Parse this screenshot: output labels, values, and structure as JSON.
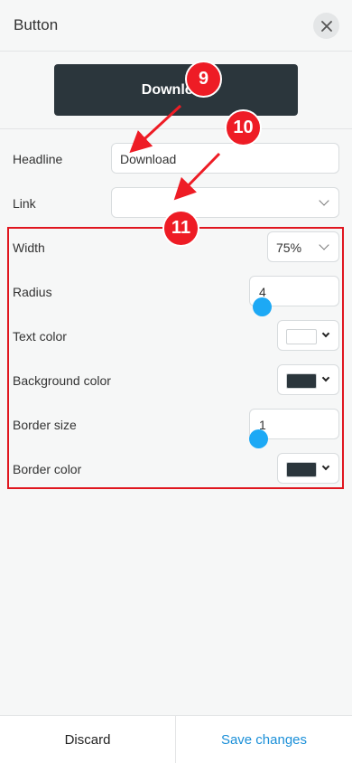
{
  "header": {
    "title": "Button",
    "close_icon": "close-icon"
  },
  "preview": {
    "button_label": "Download"
  },
  "form": {
    "headline": {
      "label": "Headline",
      "value": "Download"
    },
    "link": {
      "label": "Link",
      "value": ""
    }
  },
  "settings": {
    "width": {
      "label": "Width",
      "value": "75%"
    },
    "radius": {
      "label": "Radius",
      "value": "4"
    },
    "text_color": {
      "label": "Text color",
      "color": "#ffffff"
    },
    "background_color": {
      "label": "Background color",
      "color": "#2b363c"
    },
    "border_size": {
      "label": "Border size",
      "value": "1"
    },
    "border_color": {
      "label": "Border color",
      "color": "#2b363c"
    }
  },
  "annotations": {
    "badge_9": "9",
    "badge_10": "10",
    "badge_11": "11"
  },
  "footer": {
    "discard_label": "Discard",
    "save_label": "Save changes"
  },
  "colors": {
    "accent": "#1a8fd8",
    "annotation_red": "#ee1c25",
    "slider": "#1da9f5"
  }
}
